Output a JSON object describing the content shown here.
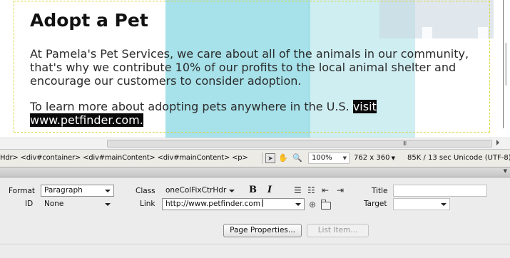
{
  "design_view": {
    "heading": "Adopt a Pet",
    "paragraph1": "At Pamela's Pet Services, we care about all of the animals in our community, that's why we contribute 10% of our profits to the local animal shelter and encourage our customers to consider adoption.",
    "paragraph2_prefix": "To learn more about adopting pets anywhere in the U.S. ",
    "paragraph2_selected": "visit www.petfinder.com."
  },
  "hscroll": {
    "grip": "III"
  },
  "status_bar": {
    "tag_path": "Hdr> <div#container> <div#mainContent> <div#mainContent> <p>",
    "tools": [
      "select-tool",
      "hand-tool",
      "zoom-tool"
    ],
    "zoom": "100%",
    "window_size": "762 x 360",
    "download": "85K / 13 sec",
    "encoding": "Unicode (UTF-8)"
  },
  "properties": {
    "format_label": "Format",
    "format_value": "Paragraph",
    "id_label": "ID",
    "id_value": "None",
    "class_label": "Class",
    "class_value": "oneColFixCtrHdr",
    "bold_label": "B",
    "italic_label": "I",
    "link_label": "Link",
    "link_value": "http://www.petfinder.com",
    "title_label": "Title",
    "title_value": "",
    "target_label": "Target",
    "target_value": "",
    "page_properties_button": "Page Properties...",
    "list_item_button": "List Item..."
  },
  "colors": {
    "selection": "#0a0a0a",
    "watermark": "#5ec8d7",
    "panel": "#ececec"
  }
}
